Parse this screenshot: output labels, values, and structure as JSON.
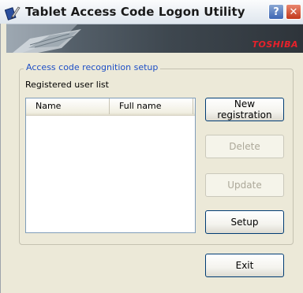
{
  "window": {
    "title": "Tablet Access Code Logon Utility",
    "help_label": "?",
    "close_label": "✕"
  },
  "banner": {
    "brand": "TOSHIBA"
  },
  "setup_group": {
    "title": "Access code recognition setup",
    "list_label": "Registered user list",
    "columns": [
      "Name",
      "Full name"
    ],
    "rows": []
  },
  "buttons": {
    "new_registration": "New registration",
    "delete": "Delete",
    "update": "Update",
    "setup": "Setup",
    "exit": "Exit"
  },
  "colors": {
    "group_title": "#1e4fc6",
    "brand": "#e8212b",
    "disabled_text": "#aca899"
  },
  "icons": {
    "app": "tablet-pen-icon",
    "help": "help-icon",
    "close": "close-icon"
  }
}
